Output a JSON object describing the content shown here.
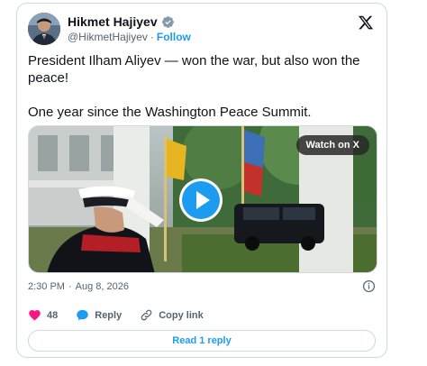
{
  "author": {
    "name": "Hikmet Hajiyev",
    "handle": "@HikmetHajiyev",
    "separator": "·",
    "follow_label": "Follow",
    "verified_icon": "verified-badge-icon",
    "verified_color": "#829aab"
  },
  "tweet": {
    "line1": "President Ilham Aliyev — won the war, but also won the peace!",
    "line2": "One year since the Washington Peace Summit."
  },
  "media": {
    "watch_label": "Watch on X",
    "play_icon": "play-icon",
    "play_color": "#1d9bf0"
  },
  "meta": {
    "time": "2:30 PM",
    "separator": "·",
    "date": "Aug 8, 2026"
  },
  "actions": {
    "likes_count": "48",
    "reply_label": "Reply",
    "copy_label": "Copy link",
    "heart_color": "#f91880",
    "reply_color": "#1d9bf0"
  },
  "footer": {
    "read_replies_label": "Read 1 reply"
  },
  "colors": {
    "accent": "#1d9bf0",
    "text": "#0f1419",
    "muted": "#536471",
    "border": "#cfd9de"
  }
}
